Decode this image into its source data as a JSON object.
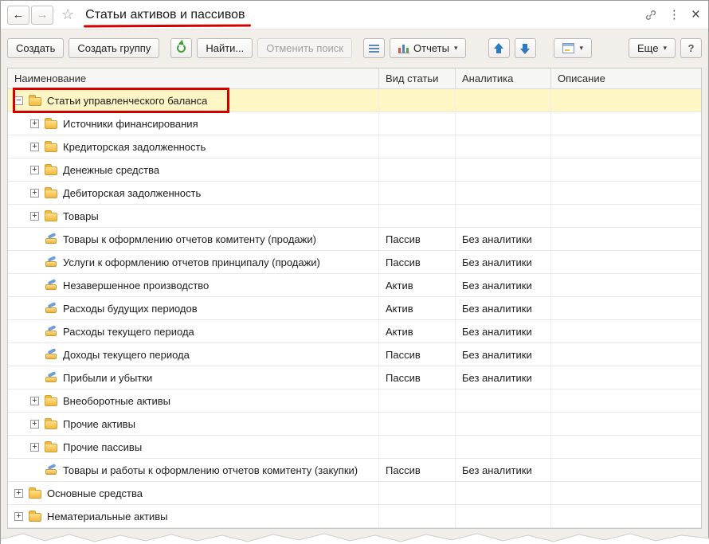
{
  "window": {
    "title": "Статьи активов и пассивов"
  },
  "chrome": {
    "back_glyph": "←",
    "forward_glyph": "→",
    "star_glyph": "☆",
    "menu_glyph": "⋮",
    "close_glyph": "×"
  },
  "toolbar": {
    "create": "Создать",
    "create_group": "Создать группу",
    "find": "Найти...",
    "cancel_search": "Отменить поиск",
    "reports": "Отчеты",
    "more": "Еще",
    "help": "?",
    "dropdown_glyph": "▾"
  },
  "glyphs": {
    "expand": "+",
    "collapse": "−"
  },
  "colors": {
    "selection": "#fff6c6",
    "annotation": "#d40000",
    "toolbar_bg": "#f2efeb"
  },
  "table": {
    "columns": [
      "Наименование",
      "Вид статьи",
      "Аналитика",
      "Описание"
    ],
    "rows": [
      {
        "label": "Статьи управленческого баланса",
        "type": "",
        "analytics": "",
        "level": 0,
        "kind": "group",
        "expander": "minus",
        "selected": true,
        "annotated": true
      },
      {
        "label": "Источники финансирования",
        "type": "",
        "analytics": "",
        "level": 1,
        "kind": "group",
        "expander": "plus"
      },
      {
        "label": "Кредиторская задолженность",
        "type": "",
        "analytics": "",
        "level": 1,
        "kind": "group",
        "expander": "plus"
      },
      {
        "label": "Денежные средства",
        "type": "",
        "analytics": "",
        "level": 1,
        "kind": "group",
        "expander": "plus"
      },
      {
        "label": "Дебиторская задолженность",
        "type": "",
        "analytics": "",
        "level": 1,
        "kind": "group",
        "expander": "plus"
      },
      {
        "label": "Товары",
        "type": "",
        "analytics": "",
        "level": 1,
        "kind": "group",
        "expander": "plus"
      },
      {
        "label": "Товары к оформлению отчетов комитенту (продажи)",
        "type": "Пассив",
        "analytics": "Без аналитики",
        "level": 1,
        "kind": "item"
      },
      {
        "label": "Услуги к оформлению отчетов принципалу (продажи)",
        "type": "Пассив",
        "analytics": "Без аналитики",
        "level": 1,
        "kind": "item"
      },
      {
        "label": "Незавершенное производство",
        "type": "Актив",
        "analytics": "Без аналитики",
        "level": 1,
        "kind": "item"
      },
      {
        "label": "Расходы будущих периодов",
        "type": "Актив",
        "analytics": "Без аналитики",
        "level": 1,
        "kind": "item"
      },
      {
        "label": "Расходы текущего периода",
        "type": "Актив",
        "analytics": "Без аналитики",
        "level": 1,
        "kind": "item"
      },
      {
        "label": "Доходы текущего периода",
        "type": "Пассив",
        "analytics": "Без аналитики",
        "level": 1,
        "kind": "item"
      },
      {
        "label": "Прибыли и убытки",
        "type": "Пассив",
        "analytics": "Без аналитики",
        "level": 1,
        "kind": "item"
      },
      {
        "label": "Внеоборотные активы",
        "type": "",
        "analytics": "",
        "level": 1,
        "kind": "group",
        "expander": "plus"
      },
      {
        "label": "Прочие активы",
        "type": "",
        "analytics": "",
        "level": 1,
        "kind": "group",
        "expander": "plus"
      },
      {
        "label": "Прочие пассивы",
        "type": "",
        "analytics": "",
        "level": 1,
        "kind": "group",
        "expander": "plus"
      },
      {
        "label": "Товары и работы к оформлению отчетов комитенту (закупки)",
        "type": "Пассив",
        "analytics": "Без аналитики",
        "level": 1,
        "kind": "item"
      },
      {
        "label": "Основные средства",
        "type": "",
        "analytics": "",
        "level": 0,
        "kind": "group",
        "expander": "plus"
      },
      {
        "label": "Нематериальные активы",
        "type": "",
        "analytics": "",
        "level": 0,
        "kind": "group",
        "expander": "plus"
      }
    ]
  }
}
